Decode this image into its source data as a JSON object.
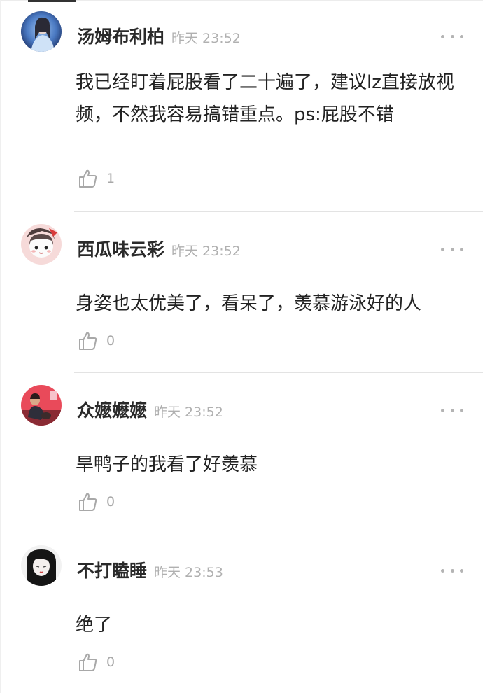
{
  "comments": [
    {
      "username": "汤姆布利柏",
      "time": "昨天 23:52",
      "text": "我已经盯着屁股看了二十遍了，建议lz直接放视频，不然我容易搞错重点。ps:屁股不错",
      "likes": "1",
      "avatar_icon": "avatar-photo"
    },
    {
      "username": "西瓜味云彩",
      "time": "昨天 23:52",
      "text": "身姿也太优美了，看呆了，羡慕游泳好的人",
      "likes": "0",
      "avatar_icon": "avatar-cartoon"
    },
    {
      "username": "众嬷嬷嬷",
      "time": "昨天 23:52",
      "text": "旱鸭子的我看了好羡慕",
      "likes": "0",
      "avatar_icon": "avatar-photo"
    },
    {
      "username": "不打瞌睡",
      "time": "昨天 23:53",
      "text": "绝了",
      "likes": "0",
      "avatar_icon": "avatar-illustration"
    }
  ],
  "icons": {
    "like": "thumbs-up-icon",
    "more": "more-icon"
  },
  "colors": {
    "text": "#222222",
    "username": "#2a2a2a",
    "meta": "#b0b0b0",
    "divider": "#e3e3e3"
  }
}
